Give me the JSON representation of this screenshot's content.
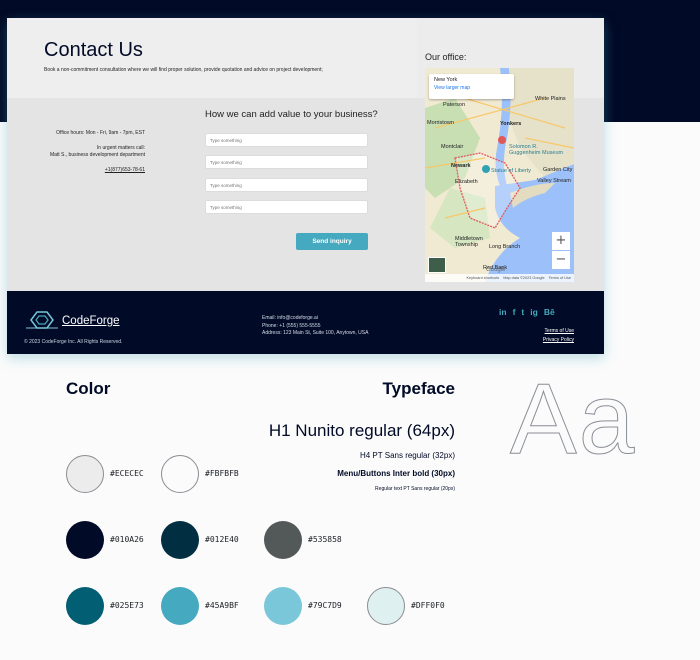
{
  "contact": {
    "title": "Contact Us",
    "subtitle": "Book a non-commitment consultation where we will find proper solution, provide quotation and advice on project development;"
  },
  "office_info": {
    "hours": "Office hours: Mon - Fri, 9am - 7pm, EST",
    "urgent": "In urgent matters call:",
    "person": "Matt S., business development department",
    "phone": "+1(877)653-78-61"
  },
  "form": {
    "question": "How we can add value to your business?",
    "placeholders": [
      "Type something",
      "Type something",
      "Type something",
      "Type something"
    ],
    "submit_label": "Send inquiry"
  },
  "map": {
    "office_label": "Our office:",
    "city": "New York",
    "larger_map_link": "View larger map",
    "zoom_in": "+",
    "zoom_out": "−",
    "google_label": "Google",
    "labels": [
      "Yonkers",
      "White Plains",
      "Solomon R. Guggenheim Museum",
      "Statue of Liberty",
      "Newark",
      "Valley Stream",
      "Garden City",
      "Elizabeth",
      "Middletown Township",
      "Long Branch",
      "Red Bank",
      "Paterson",
      "Montclair",
      "Morristown"
    ],
    "footer": {
      "shortcuts": "Keyboard shortcuts",
      "map_data": "Map data ©2023 Google",
      "terms": "Terms of Use"
    }
  },
  "footer": {
    "brand": "CodeForge",
    "copyright": "© 2023 CodeForge Inc. All Rights Reserved.",
    "email": "Email: info@codeforge.ai",
    "phone": "Phone: +1 (555) 555-5555",
    "address": "Address: 123 Main St, Suite 100, Anytown, USA",
    "socials": [
      "in",
      "f",
      "t",
      "ig",
      "Bē"
    ],
    "terms": "Terms of Use",
    "privacy": "Privacy Policy"
  },
  "style_guide": {
    "color_title": "Color",
    "typeface_title": "Typeface",
    "h1_sample": "H1 Nunito regular (64px)",
    "h4_sample": "H4 PT Sans regular (32px)",
    "menu_sample": "Menu/Buttons Inter bold (30px)",
    "regular_sample": "Regular text PT Sans regular (20px)",
    "aa_glyphs": "Aa",
    "colors": [
      {
        "hex": "#ECECEC",
        "label": "#ECECEC"
      },
      {
        "hex": "#FBFBFB",
        "label": "#FBFBFB"
      },
      {
        "hex": "#010A26",
        "label": "#010A26"
      },
      {
        "hex": "#012E40",
        "label": "#012E40"
      },
      {
        "hex": "#535858",
        "label": "#535858"
      },
      {
        "hex": "#025E73",
        "label": "#025E73"
      },
      {
        "hex": "#45A9BF",
        "label": "#45A9BF"
      },
      {
        "hex": "#79C7D9",
        "label": "#79C7D9"
      },
      {
        "hex": "#DFF0F0",
        "label": "#DFF0F0"
      }
    ]
  },
  "accent_colors": {
    "primary": "#45A9BF",
    "dark": "#010A26"
  }
}
